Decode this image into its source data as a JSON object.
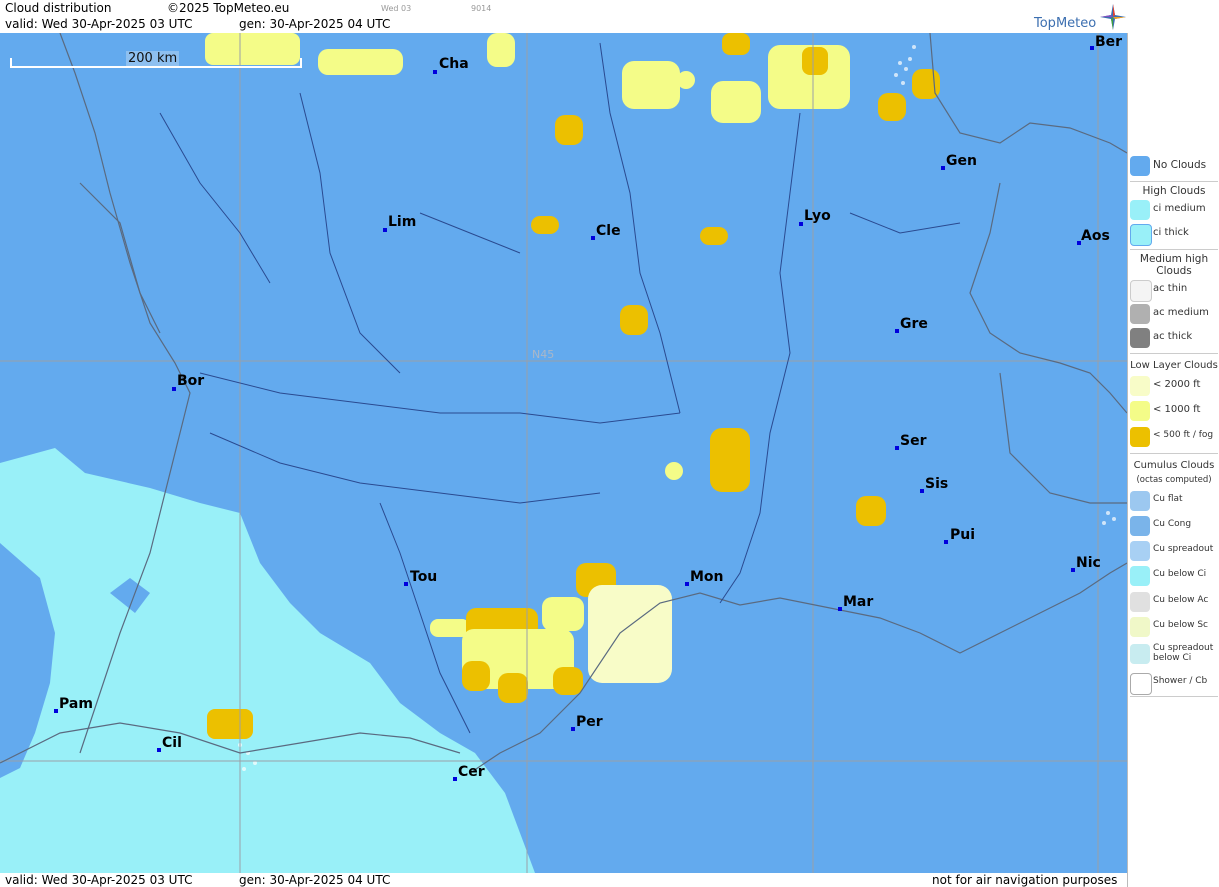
{
  "header": {
    "title": "Cloud distribution",
    "copyright": "©2025 TopMeteo.eu",
    "small_tag_1": "Wed 03",
    "small_tag_2": "9014",
    "valid": "valid:  Wed  30-Apr-2025  03 UTC",
    "gen": "gen: 30-Apr-2025 04 UTC",
    "brand": "TopMeteo"
  },
  "map": {
    "scale_label": "200 km",
    "latitude_label": "N45",
    "cities": [
      "Cha",
      "Ber",
      "Gen",
      "Lim",
      "Cle",
      "Lyo",
      "Aos",
      "Gre",
      "Bor",
      "Ser",
      "Sis",
      "Pui",
      "Tou",
      "Mon",
      "Mar",
      "Nic",
      "Pam",
      "Cil",
      "Per",
      "Cer"
    ]
  },
  "footer": {
    "valid": "valid:  Wed  30-Apr-2025  03 UTC",
    "gen": "gen: 30-Apr-2025 04 UTC",
    "disclaimer": "not for air navigation purposes"
  },
  "legend": {
    "no_clouds": "No Clouds",
    "high_clouds": "High Clouds",
    "ci_medium": "ci medium",
    "ci_thick": "ci thick",
    "medium_high_clouds": "Medium high Clouds",
    "ac_thin": "ac thin",
    "ac_medium": "ac medium",
    "ac_thick": "ac thick",
    "low_layer_clouds": "Low Layer Clouds",
    "lt_2000": "< 2000 ft",
    "lt_1000": "< 1000 ft",
    "lt_500": "< 500 ft / fog",
    "cumulus_clouds": "Cumulus Clouds",
    "cumulus_sub": "(octas computed)",
    "cu_flat": "Cu flat",
    "cu_cong": "Cu Cong",
    "cu_spreadout": "Cu spreadout",
    "cu_below_ci": "Cu below Ci",
    "cu_below_ac": "Cu below Ac",
    "cu_below_sc": "Cu below Sc",
    "cu_spreadout_below_ci": "Cu spreadout below Ci",
    "shower_cb": "Shower / Cb"
  },
  "colors": {
    "no_clouds": "#63aaee",
    "ci": "#99f0f8",
    "lt_2000": "#f8fcc8",
    "lt_1000": "#f4fc88",
    "lt_500": "#ecc000"
  }
}
